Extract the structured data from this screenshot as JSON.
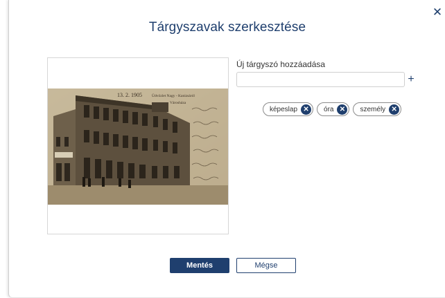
{
  "dialog": {
    "title": "Tárgyszavak szerkesztése",
    "close_icon": "close-icon"
  },
  "preview": {
    "image_icon": "postcard-image",
    "handwriting": "13. 2. 1905",
    "postcard_caption": "Üdvözlet Nagy - Kanizsáról",
    "postcard_subcaption": "Városháza"
  },
  "keyword_form": {
    "label": "Új tárgyszó hozzáadása",
    "input_value": "",
    "add_label": "+"
  },
  "tags": [
    {
      "label": "képeslap",
      "remove_icon": "remove-icon"
    },
    {
      "label": "óra",
      "remove_icon": "remove-icon"
    },
    {
      "label": "személy",
      "remove_icon": "remove-icon"
    }
  ],
  "footer": {
    "save_label": "Mentés",
    "cancel_label": "Mégse"
  },
  "colors": {
    "accent": "#1f3f6e",
    "border": "#cfcfcf",
    "sepia": "#b9a989"
  }
}
